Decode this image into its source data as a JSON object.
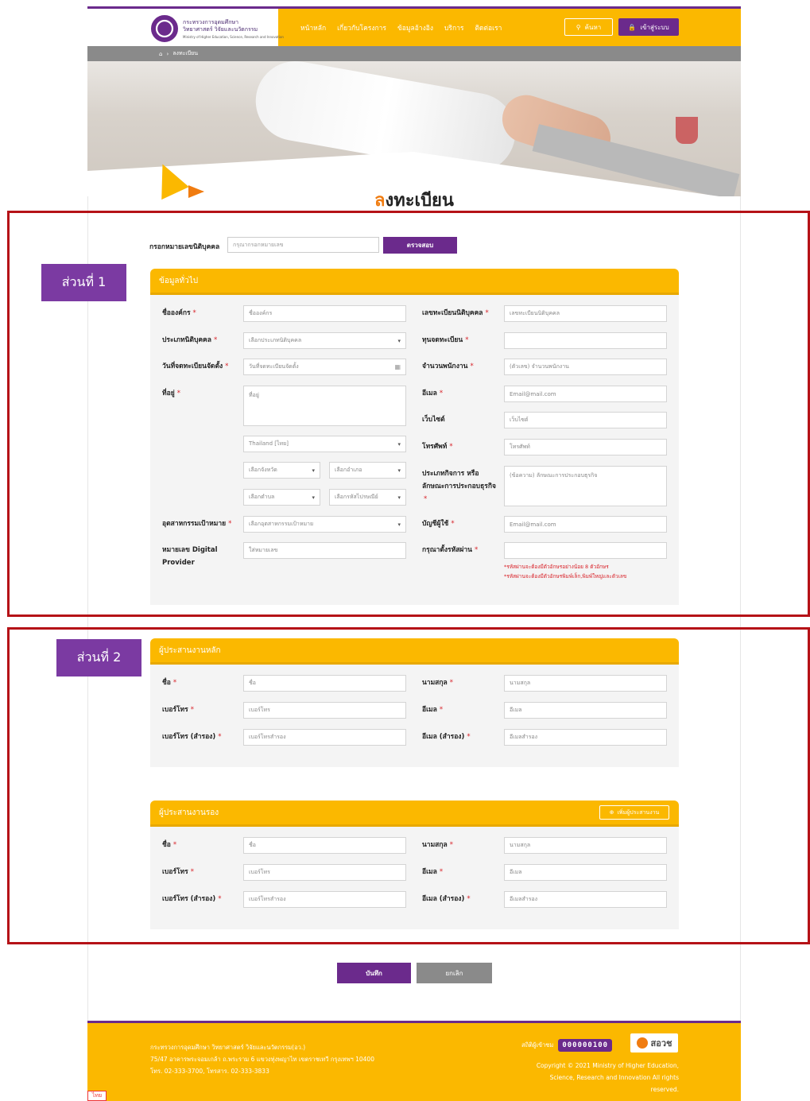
{
  "header": {
    "logo_line1": "กระทรวงการอุดมศึกษา",
    "logo_line2": "วิทยาศาสตร์ วิจัยและนวัตกรรม",
    "logo_line3": "Ministry of Higher Education, Science, Research and Innovation",
    "nav": [
      "หน้าหลัก",
      "เกี่ยวกับโครงการ",
      "ข้อมูลอ้างอิง",
      "บริการ",
      "ติดต่อเรา"
    ],
    "search_label": "ค้นหา",
    "login_label": "เข้าสู่ระบบ"
  },
  "breadcrumb": {
    "current": "ลงทะเบียน"
  },
  "page_title": {
    "first": "ล",
    "rest": "งทะเบียน"
  },
  "annotations": {
    "section1": "ส่วนที่ 1",
    "section2": "ส่วนที่ 2"
  },
  "check": {
    "label": "กรอกหมายเลขนิติบุคคล",
    "placeholder": "กรุณากรอกหมายเลข",
    "button": "ตรวจสอบ"
  },
  "general": {
    "title": "ข้อมูลทั่วไป",
    "org_name_label": "ชื่อองค์กร",
    "org_name_placeholder": "ชื่อองค์กร",
    "reg_no_label": "เลขทะเบียนนิติบุคคล",
    "reg_no_placeholder": "เลขทะเบียนนิติบุคคล",
    "entity_type_label": "ประเภทนิติบุคคล",
    "entity_type_value": "เลือกประเภทนิติบุคคล",
    "capital_label": "ทุนจดทะเบียน",
    "capital_value": "",
    "reg_date_label": "วันที่จดทะเบียนจัดตั้ง",
    "reg_date_placeholder": "วันที่จดทะเบียนจัดตั้ง",
    "employees_label": "จำนวนพนักงาน",
    "employees_placeholder": "(ตัวเลข) จำนวนพนักงาน",
    "address_label": "ที่อยู่",
    "address_placeholder": "ที่อยู่",
    "email_label": "อีเมล",
    "email_placeholder": "Email@mail.com",
    "website_label": "เว็บไซต์",
    "website_placeholder": "เว็บไซต์",
    "country_value": "Thailand [ไทย]",
    "phone_label": "โทรศัพท์",
    "phone_placeholder": "โทรศัพท์",
    "province_value": "เลือกจังหวัด",
    "district_value": "เลือกอำเภอ",
    "subdistrict_value": "เลือกตำบล",
    "postcode_value": "เลือกรหัสไปรษณีย์",
    "business_type_label_1": "ประเภทกิจการ หรือ",
    "business_type_label_2": "ลักษณะการประกอบธุรกิจ",
    "business_type_placeholder": "(ข้อความ) ลักษณะการประกอบธุรกิจ",
    "industry_label": "อุตสาหกรรมเป้าหมาย",
    "industry_value": "เลือกอุตสาหกรรมเป้าหมาย",
    "account_label": "บัญชีผู้ใช้",
    "account_placeholder": "Email@mail.com",
    "digital_provider_label_1": "หมายเลข Digital",
    "digital_provider_label_2": "Provider",
    "digital_provider_placeholder": "ใส่หมายเลข",
    "password_label": "กรุณาตั้งรหัสผ่าน",
    "password_value": "",
    "password_hint_1": "*รหัสผ่านจะต้องมีตัวอักษรอย่างน้อย 8 ตัวอักษร",
    "password_hint_2": "*รหัสผ่านจะต้องมีตัวอักษรพิมพ์เล็ก,พิมพ์ใหญ่และตัวเลข"
  },
  "primary": {
    "title": "ผู้ประสานงานหลัก",
    "name_label": "ชื่อ",
    "name_placeholder": "ชื่อ",
    "surname_label": "นามสกุล",
    "surname_placeholder": "นามสกุล",
    "phone_label": "เบอร์โทร",
    "phone_placeholder": "เบอร์โทร",
    "email_label": "อีเมล",
    "email_placeholder": "อีเมล",
    "phone2_label": "เบอร์โทร (สำรอง)",
    "phone2_placeholder": "เบอร์โทรสำรอง",
    "email2_label": "อีเมล (สำรอง)",
    "email2_placeholder": "อีเมลสำรอง"
  },
  "secondary": {
    "title": "ผู้ประสานงานรอง",
    "add_button": "เพิ่มผู้ประสานงาน",
    "name_label": "ชื่อ",
    "name_placeholder": "ชื่อ",
    "surname_label": "นามสกุล",
    "surname_placeholder": "นามสกุล",
    "phone_label": "เบอร์โทร",
    "phone_placeholder": "เบอร์โทร",
    "email_label": "อีเมล",
    "email_placeholder": "อีเมล",
    "phone2_label": "เบอร์โทร (สำรอง)",
    "phone2_placeholder": "เบอร์โทรสำรอง",
    "email2_label": "อีเมล (สำรอง)",
    "email2_placeholder": "อีเมลสำรอง"
  },
  "actions": {
    "save": "บันทึก",
    "cancel": "ยกเลิก"
  },
  "footer": {
    "line1": "กระทรวงการอุดมศึกษา วิทยาศาสตร์ วิจัยและนวัตกรรม(อว.)",
    "line2": "75/47 อาคารพระจอมเกล้า ถ.พระราม 6 แขวงทุ่งพญาไท เขตราชเทวี กรุงเทพฯ 10400",
    "line3": "โทร. 02-333-3700, โทรสาร. 02-333-3833",
    "visitor_label": "สถิติผู้เข้าชม",
    "visitor_count": "000000100",
    "brand": "สอวช",
    "copyright_1": "Copyright © 2021 Ministry of Higher Education,",
    "copyright_2": "Science, Research and Innovation All rights",
    "copyright_3": "reserved."
  },
  "corner_badge": "ไทย",
  "colors": {
    "primary": "#fbb800",
    "accent": "#6b2a8c",
    "required": "#d81f26",
    "annotation": "#b51217"
  }
}
